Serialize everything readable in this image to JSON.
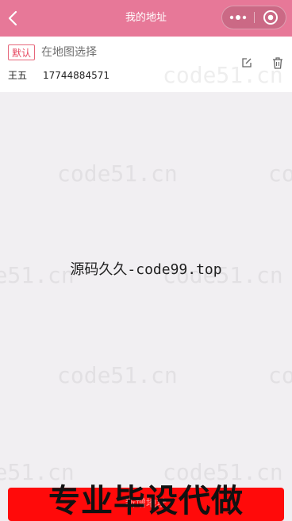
{
  "navbar": {
    "title": "我的地址",
    "back_icon": "chevron-left-icon",
    "more_icon": "more-dots-icon",
    "close_icon": "target-circle-icon",
    "color": "#e77898"
  },
  "address_card": {
    "default_tag": "默认",
    "address": "在地图选择",
    "name": "王五",
    "phone": "17744884571",
    "edit_icon": "edit-icon",
    "delete_icon": "trash-icon"
  },
  "overlay": {
    "center_text": "源码久久-code99.top",
    "banner_text": "专业毕设代做",
    "watermark": "code51.cn"
  },
  "add_button": {
    "label": "新增地址",
    "color": "#ff0a0a"
  }
}
